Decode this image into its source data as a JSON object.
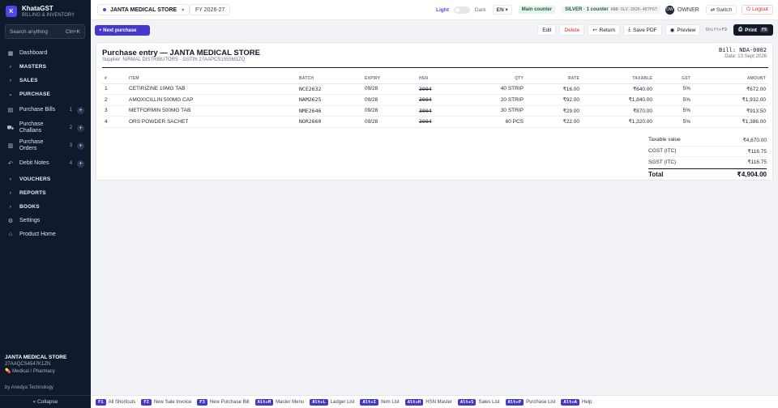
{
  "app": {
    "name": "KhataGST",
    "tagline": "BILLING & INVENTORY",
    "logo_letter": "K"
  },
  "search": {
    "placeholder": "Search anything",
    "shortcut": "Ctrl+K"
  },
  "nav": {
    "dashboard": "Dashboard",
    "masters": "MASTERS",
    "sales": "SALES",
    "purchase": "PURCHASE",
    "purchase_bills": {
      "label": "Purchase Bills",
      "count": "1"
    },
    "purchase_challans": {
      "label": "Purchase Challans",
      "count": "2"
    },
    "purchase_orders": {
      "label": "Purchase Orders",
      "count": "3"
    },
    "debit_notes": {
      "label": "Debit Notes",
      "count": "4"
    },
    "vouchers": "VOUCHERS",
    "reports": "REPORTS",
    "books": "BOOKS",
    "settings": "Settings",
    "product_home": "Product Home"
  },
  "sidebar_footer": {
    "store_name": "JANTA MEDICAL STORE",
    "gstin": "27AAQCS4547K1ZN",
    "category": "Medical / Pharmacy",
    "byline": "by Anedya Technology",
    "collapse": "« Collapse"
  },
  "topbar": {
    "store": "JANTA MEDICAL STORE",
    "fy": "FY 2026-27",
    "theme_light": "Light",
    "theme_dark": "Dark",
    "language": "EN",
    "counter": "Main counter",
    "plan": "SILVER · 1 counter",
    "plan_code": "ANB-SLV-2026-4E7F67",
    "avatar": "OW",
    "role": "OWNER",
    "switch": "Switch",
    "logout": "Logout"
  },
  "actions": {
    "next_purchase": "+ Next purchase",
    "edit": "Edit",
    "delete": "Delete",
    "return": "Return",
    "save_pdf": "Save PDF",
    "preview": "Preview",
    "preview_shortcut": "Shift+F9",
    "print": "Print",
    "print_key": "F9"
  },
  "doc": {
    "title": "Purchase entry — JANTA MEDICAL STORE",
    "supplier": "Supplier: NIRMAL DISTRIBUTORS · GSTIN 27AAPCS1555M1ZQ",
    "bill_no": "Bill: NDA-0002",
    "date": "Date: 13 Sept 2026",
    "columns": {
      "num": "#",
      "item": "ITEM",
      "batch": "BATCH",
      "expiry": "EXPIRY",
      "hsn": "HSN",
      "qty": "QTY",
      "rate": "RATE",
      "taxable": "TAXABLE",
      "gst": "GST",
      "amount": "AMOUNT"
    },
    "rows": [
      {
        "num": "1",
        "item": "CETIRIZINE 10MG TAB",
        "batch": "NCE2632",
        "expiry": "09/28",
        "hsn": "3004",
        "qty": "40 STRIP",
        "rate": "₹16.00",
        "taxable": "₹640.00",
        "gst": "5%",
        "amount": "₹672.00"
      },
      {
        "num": "2",
        "item": "AMOXICILLIN 500MG CAP",
        "batch": "NAM2625",
        "expiry": "09/28",
        "hsn": "3004",
        "qty": "20 STRIP",
        "rate": "₹92.00",
        "taxable": "₹1,840.00",
        "gst": "5%",
        "amount": "₹1,932.00"
      },
      {
        "num": "3",
        "item": "METFORMIN 500MG TAB",
        "batch": "NME2646",
        "expiry": "09/28",
        "hsn": "3004",
        "qty": "30 STRIP",
        "rate": "₹29.00",
        "taxable": "₹870.00",
        "gst": "5%",
        "amount": "₹913.50"
      },
      {
        "num": "4",
        "item": "ORS POWDER SACHET",
        "batch": "NOR2660",
        "expiry": "09/28",
        "hsn": "3004",
        "qty": "60 PCS",
        "rate": "₹22.00",
        "taxable": "₹1,320.00",
        "gst": "5%",
        "amount": "₹1,386.00"
      }
    ],
    "totals": {
      "taxable_label": "Taxable value",
      "taxable_value": "₹4,670.00",
      "cgst_label": "CGST (ITC)",
      "cgst_value": "₹116.75",
      "sgst_label": "SGST (ITC)",
      "sgst_value": "₹116.75",
      "total_label": "Total",
      "total_value": "₹4,904.00"
    }
  },
  "shortcuts": [
    {
      "key": "F1",
      "label": "All Shortcuts"
    },
    {
      "key": "F2",
      "label": "New Sale Invoice"
    },
    {
      "key": "F3",
      "label": "New Purchase Bill"
    },
    {
      "key": "Alt+M",
      "label": "Master Menu"
    },
    {
      "key": "Alt+L",
      "label": "Ledger List"
    },
    {
      "key": "Alt+I",
      "label": "Item List"
    },
    {
      "key": "Alt+H",
      "label": "HSN Master"
    },
    {
      "key": "Alt+S",
      "label": "Sales List"
    },
    {
      "key": "Alt+P",
      "label": "Purchase List"
    },
    {
      "key": "Alt+A",
      "label": "Help"
    }
  ],
  "colors": {
    "sidebar_bg": "#101a2d",
    "accent": "#4338ca",
    "danger": "#dc2626",
    "success": "#166534"
  }
}
